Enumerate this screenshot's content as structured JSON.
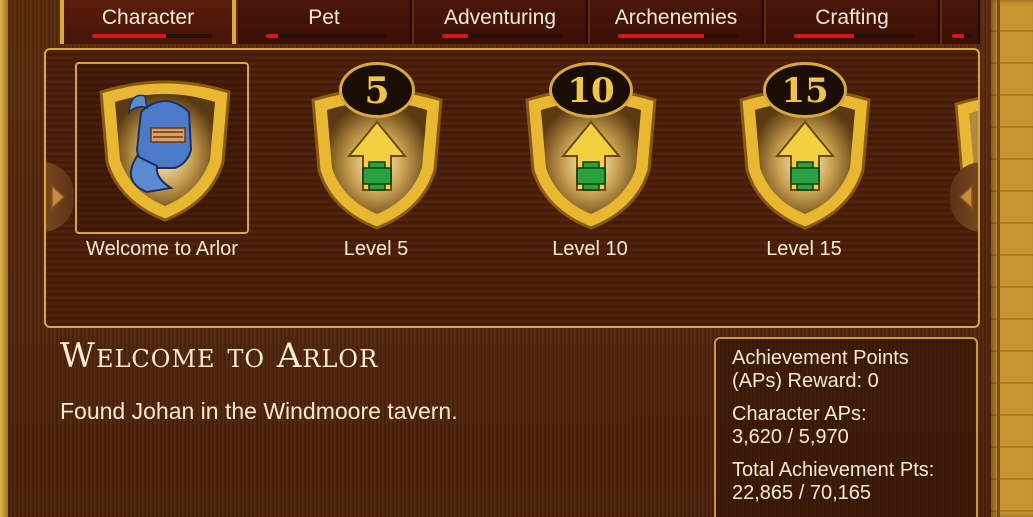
{
  "tabs": [
    {
      "label": "Character",
      "progress": 0.62,
      "active": true
    },
    {
      "label": "Pet",
      "progress": 0.1,
      "active": false
    },
    {
      "label": "Adventuring",
      "progress": 0.22,
      "active": false
    },
    {
      "label": "Archenemies",
      "progress": 0.72,
      "active": false
    },
    {
      "label": "Crafting",
      "progress": 0.5,
      "active": false
    }
  ],
  "achievements": [
    {
      "label": "Welcome to Arlor",
      "badge": "",
      "icon": "knight-helmet-icon"
    },
    {
      "label": "Level 5",
      "badge": "5",
      "icon": "level-up-arrow-icon"
    },
    {
      "label": "Level 10",
      "badge": "10",
      "icon": "level-up-arrow-icon"
    },
    {
      "label": "Level 15",
      "badge": "15",
      "icon": "level-up-arrow-icon"
    }
  ],
  "detail": {
    "title": "Welcome to Arlor",
    "description": "Found Johan in the Windmoore tavern."
  },
  "stats": {
    "reward_label": "Achievement Points",
    "reward_value": "(APs) Reward: 0",
    "character_label": "Character APs:",
    "character_value": "3,620 / 5,970",
    "total_label": "Total Achievement Pts:",
    "total_value": "22,865 / 70,165"
  },
  "colors": {
    "gold": "#d8a83c",
    "progress_red": "#d41a10",
    "background": "#4a1e08"
  }
}
